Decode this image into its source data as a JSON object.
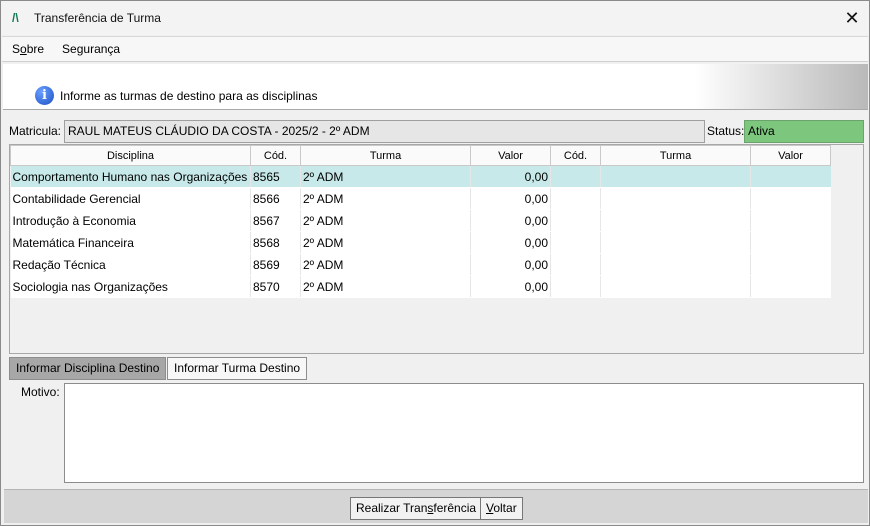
{
  "window": {
    "title": "Transferência de Turma",
    "close_glyph": "✕",
    "icon": "logo-icon"
  },
  "menu": {
    "items": [
      {
        "pre": "S",
        "underline": "o",
        "post": "bre"
      },
      {
        "pre": "",
        "underline": "",
        "post": "Segurança"
      }
    ]
  },
  "banner": {
    "text": "Informe as turmas de destino para as disciplinas",
    "icon_glyph": "i"
  },
  "matricula": {
    "label": "Matricula:",
    "value": "RAUL MATEUS CLÁUDIO DA COSTA - 2025/2 - 2º ADM"
  },
  "status": {
    "label": "Status:",
    "value": "Ativa",
    "color": "#7cc67e"
  },
  "grid": {
    "headers": [
      "Disciplina",
      "Cód.",
      "Turma",
      "Valor",
      "Cód.",
      "Turma",
      "Valor"
    ],
    "rows": [
      {
        "disciplina": "Comportamento Humano nas Organizações",
        "cod": "8565",
        "turma": "2º ADM",
        "valor": "0,00",
        "cod2": "",
        "turma2": "",
        "valor2": ""
      },
      {
        "disciplina": "Contabilidade Gerencial",
        "cod": "8566",
        "turma": "2º ADM",
        "valor": "0,00",
        "cod2": "",
        "turma2": "",
        "valor2": ""
      },
      {
        "disciplina": "Introdução à Economia",
        "cod": "8567",
        "turma": "2º ADM",
        "valor": "0,00",
        "cod2": "",
        "turma2": "",
        "valor2": ""
      },
      {
        "disciplina": "Matemática Financeira",
        "cod": "8568",
        "turma": "2º ADM",
        "valor": "0,00",
        "cod2": "",
        "turma2": "",
        "valor2": ""
      },
      {
        "disciplina": "Redação Técnica",
        "cod": "8569",
        "turma": "2º ADM",
        "valor": "0,00",
        "cod2": "",
        "turma2": "",
        "valor2": ""
      },
      {
        "disciplina": "Sociologia nas Organizações",
        "cod": "8570",
        "turma": "2º ADM",
        "valor": "0,00",
        "cod2": "",
        "turma2": "",
        "valor2": ""
      }
    ]
  },
  "tabs": {
    "disciplina": "Informar Disciplina Destino",
    "turma": "Informar Turma Destino"
  },
  "motivo": {
    "label": "Motivo:",
    "value": ""
  },
  "buttons": {
    "realizar": {
      "pre": "Realizar Tran",
      "underline": "s",
      "post": "ferência"
    },
    "voltar": {
      "pre": "",
      "underline": "V",
      "post": "oltar"
    }
  },
  "colors": {
    "selected_row": "#c7e9e9",
    "active_tab": "#a7a7a7"
  }
}
